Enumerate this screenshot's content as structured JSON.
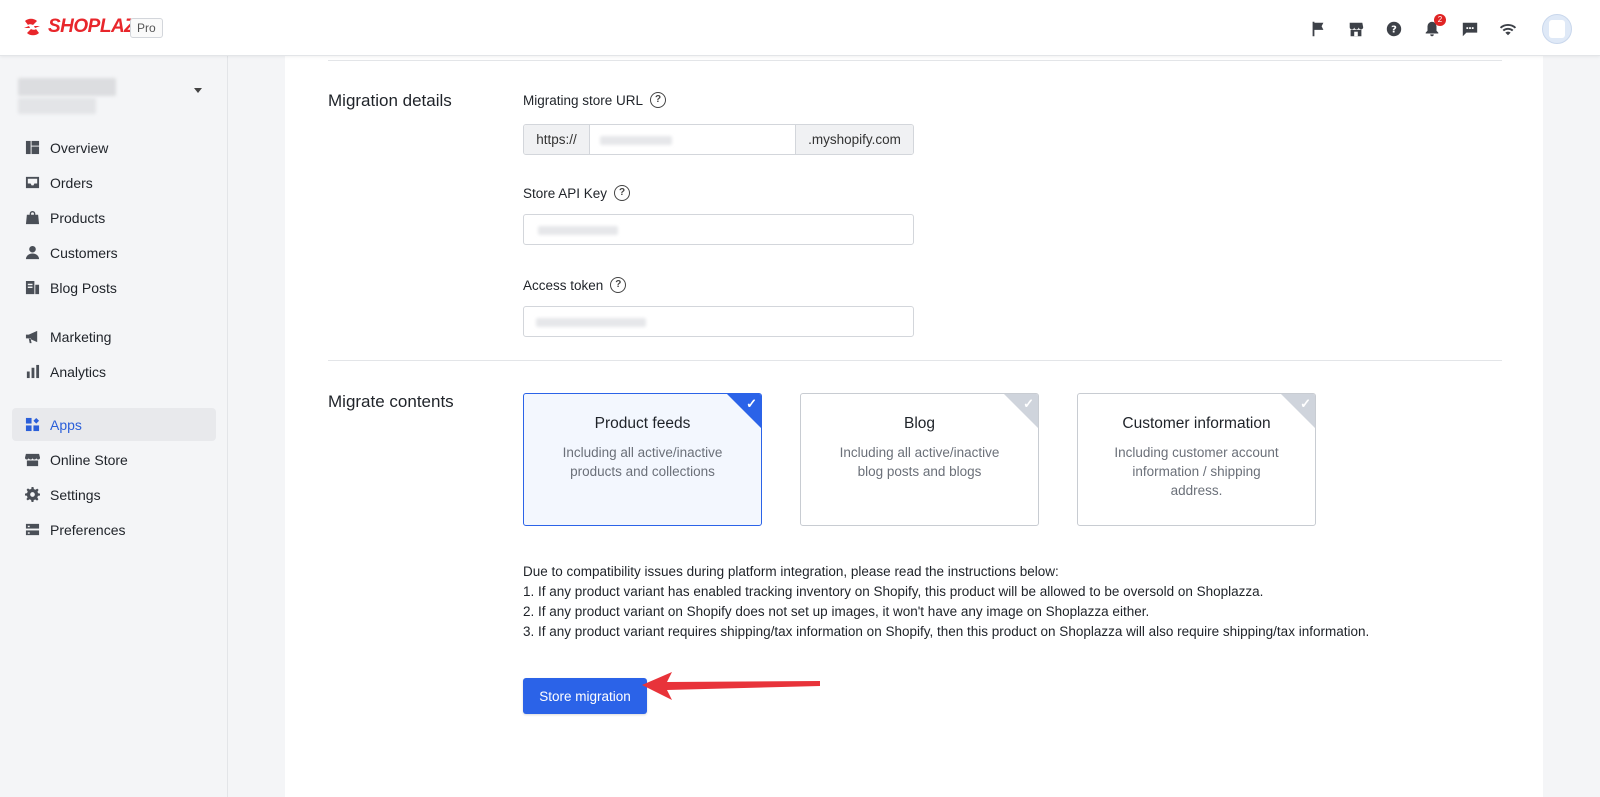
{
  "header": {
    "brand": "SHOPLAZZA",
    "plan_badge": "Pro",
    "notification_count": "2",
    "icons": [
      "flag-icon",
      "store-icon",
      "help-icon",
      "bell-icon",
      "chat-icon",
      "wifi-icon"
    ]
  },
  "sidebar": {
    "groups": [
      [
        {
          "label": "Overview",
          "icon": "dashboard-icon"
        },
        {
          "label": "Orders",
          "icon": "inbox-icon"
        },
        {
          "label": "Products",
          "icon": "bag-icon"
        },
        {
          "label": "Customers",
          "icon": "person-icon"
        },
        {
          "label": "Blog Posts",
          "icon": "blog-icon"
        }
      ],
      [
        {
          "label": "Marketing",
          "icon": "megaphone-icon"
        },
        {
          "label": "Analytics",
          "icon": "bar-chart-icon"
        }
      ],
      [
        {
          "label": "Apps",
          "icon": "apps-icon",
          "active": true
        },
        {
          "label": "Online Store",
          "icon": "storefront-icon"
        },
        {
          "label": "Settings",
          "icon": "gear-icon"
        },
        {
          "label": "Preferences",
          "icon": "server-icon"
        }
      ]
    ]
  },
  "migration": {
    "section_title": "Migration details",
    "url_label": "Migrating store URL",
    "url_prefix": "https://",
    "url_suffix": ".myshopify.com",
    "api_key_label": "Store API Key",
    "token_label": "Access token"
  },
  "contents": {
    "section_title": "Migrate contents",
    "options": [
      {
        "title": "Product feeds",
        "desc": "Including all active/inactive products and collections",
        "selected": true
      },
      {
        "title": "Blog",
        "desc": "Including all active/inactive blog posts and blogs",
        "selected": false
      },
      {
        "title": "Customer information",
        "desc": "Including customer account information / shipping address.",
        "selected": false
      }
    ],
    "notes": [
      "Due to compatibility issues during platform integration, please read the instructions below:",
      "1. If any product variant has enabled tracking inventory on Shopify, this product will be allowed to be oversold on Shoplazza.",
      "2. If any product variant on Shopify does not set up images, it won't have any image on Shoplazza either.",
      "3. If any product variant requires shipping/tax information on Shopify, then this product on Shoplazza will also require shipping/tax information."
    ],
    "submit_label": "Store migration"
  },
  "colors": {
    "accent": "#2b63e8",
    "brand": "#e8262b",
    "arrow": "#e8333a"
  }
}
